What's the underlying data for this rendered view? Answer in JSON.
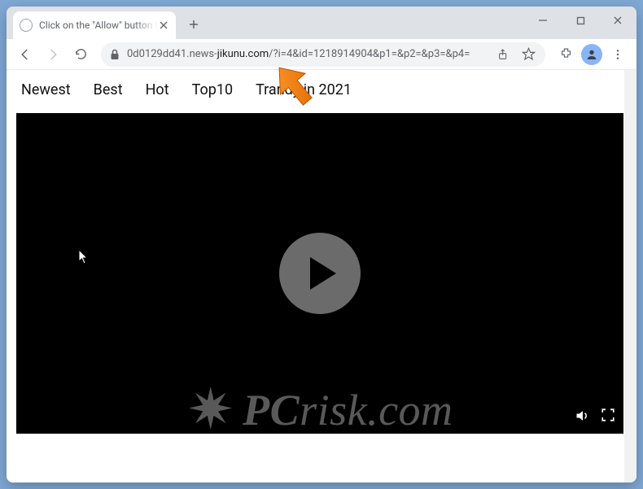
{
  "window": {
    "tab_title": "Click on the \"Allow\" button to pla",
    "minimize_label": "Minimize",
    "maximize_label": "Maximize",
    "close_label": "Close"
  },
  "toolbar": {
    "back_label": "Back",
    "forward_label": "Forward",
    "reload_label": "Reload",
    "url_prefix": "0d0129dd41.news-",
    "url_domain": "jikunu.com",
    "url_path": "/?i=4&id=1218914904&p1=&p2=&p3=&p4=",
    "share_label": "Share",
    "star_label": "Bookmark",
    "extensions_label": "Extensions",
    "profile_label": "Profile",
    "menu_label": "Menu"
  },
  "nav": {
    "items": [
      "Newest",
      "Best",
      "Hot",
      "Top10",
      "Trandy in 2021"
    ]
  },
  "player": {
    "play_label": "Play",
    "volume_label": "Volume",
    "fullscreen_label": "Fullscreen"
  },
  "watermark": {
    "text_pc": "PC",
    "text_rest": "risk.com"
  }
}
